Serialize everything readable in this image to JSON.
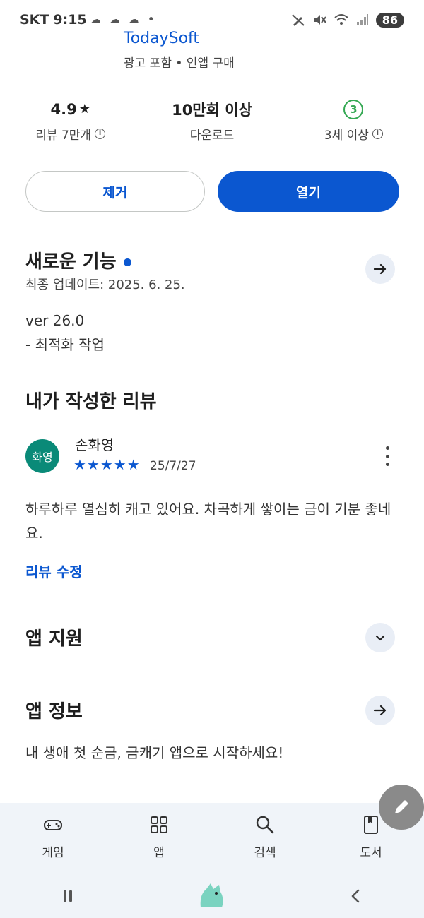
{
  "status_bar": {
    "carrier": "SKT",
    "time": "9:15",
    "notifications": "☁ ☁ ☁ •",
    "battery": "86"
  },
  "app": {
    "developer": "TodaySoft",
    "meta": "광고 포함 • 인앱 구매"
  },
  "stats": {
    "rating": "4.9",
    "rating_star": "★",
    "reviews": "리뷰 7만개",
    "downloads": "10만회 이상",
    "downloads_label": "다운로드",
    "age_badge": "3",
    "age": "3세 이상",
    "info_glyph": "i"
  },
  "buttons": {
    "uninstall": "제거",
    "open": "열기"
  },
  "whats_new": {
    "title": "새로운 기능",
    "updated": "최종 업데이트: 2025. 6. 25.",
    "version": "ver 26.0",
    "notes": "- 최적화 작업"
  },
  "my_review": {
    "title": "내가 작성한 리뷰",
    "avatar_text": "화영",
    "reviewer": "손화영",
    "stars": "★★★★★",
    "rating": 5,
    "date": "25/7/27",
    "text": "하루하루 열심히 캐고 있어요. 차곡하게 쌓이는 금이 기분 좋네요.",
    "edit_label": "리뷰 수정"
  },
  "app_support": {
    "title": "앱 지원"
  },
  "app_info": {
    "title": "앱 정보",
    "description": "내 생애 첫 순금, 금캐기 앱으로 시작하세요!"
  },
  "bottom_nav": {
    "items": [
      {
        "label": "게임",
        "icon": "gamepad-icon"
      },
      {
        "label": "앱",
        "icon": "apps-grid-icon"
      },
      {
        "label": "검색",
        "icon": "search-icon"
      },
      {
        "label": "도서",
        "icon": "book-icon"
      }
    ]
  },
  "colors": {
    "accent": "#0b57d0",
    "avatar": "#0a8a78",
    "age_badge": "#34a853",
    "nav_bg": "#f0f4f9"
  }
}
